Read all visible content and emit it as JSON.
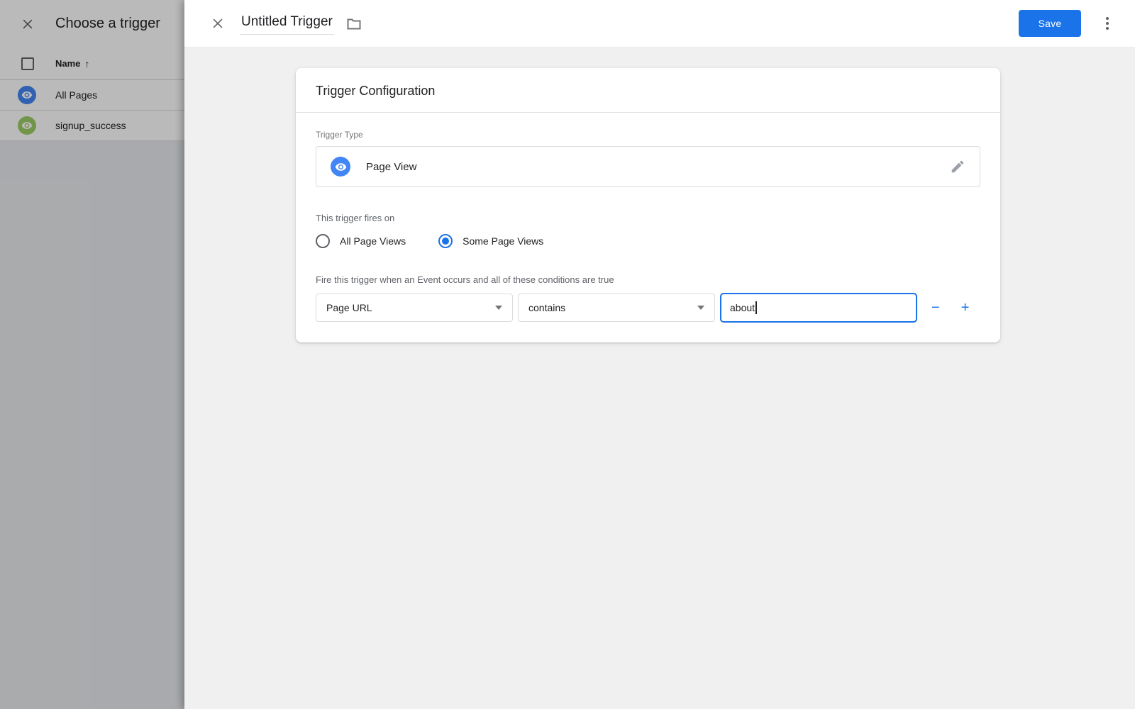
{
  "sidebar": {
    "title": "Choose a trigger",
    "name_column": "Name",
    "sort_arrow": "↑",
    "rows": [
      {
        "label": "All Pages",
        "icon": "eye",
        "color": "#4285f4"
      },
      {
        "label": "signup_success",
        "icon": "eye",
        "color": "#9ccc65"
      }
    ]
  },
  "header": {
    "title": "Untitled Trigger",
    "save_label": "Save"
  },
  "card": {
    "title": "Trigger Configuration",
    "trigger_type_label": "Trigger Type",
    "trigger_type_value": "Page View",
    "fires_on_label": "This trigger fires on",
    "fires_on_options": [
      {
        "label": "All Page Views",
        "selected": false
      },
      {
        "label": "Some Page Views",
        "selected": true
      }
    ],
    "conditions_label": "Fire this trigger when an Event occurs and all of these conditions are true",
    "condition": {
      "variable": "Page URL",
      "operator": "contains",
      "value": "about"
    },
    "remove_label": "−",
    "add_label": "+"
  },
  "colors": {
    "accent": "#1a73e8",
    "pageview_icon_blue": "#4285f4",
    "event_icon_green": "#9ccc65"
  }
}
